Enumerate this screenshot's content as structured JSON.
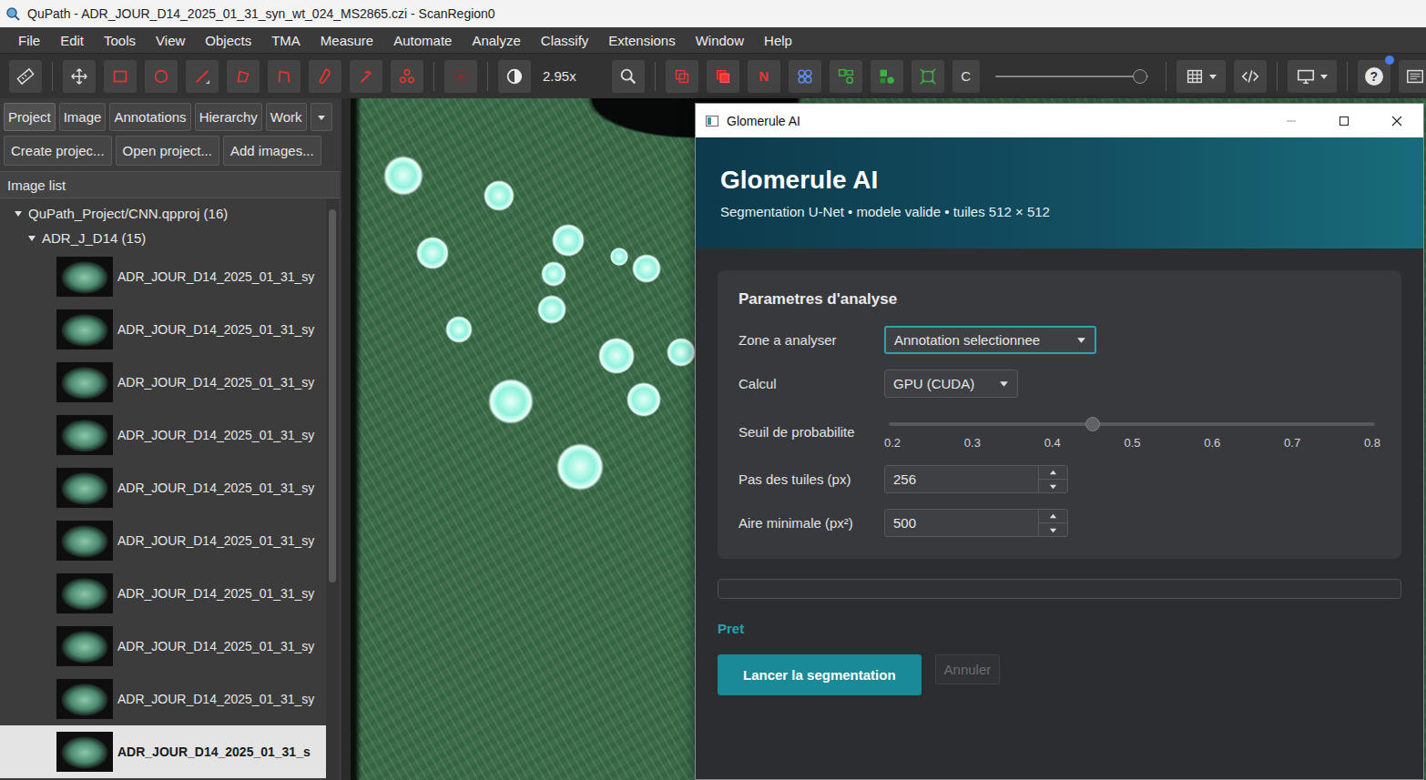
{
  "window": {
    "title": "QuPath - ADR_JOUR_D14_2025_01_31_syn_wt_024_MS2865.czi - ScanRegion0"
  },
  "menu": [
    "File",
    "Edit",
    "Tools",
    "View",
    "Objects",
    "TMA",
    "Measure",
    "Automate",
    "Analyze",
    "Classify",
    "Extensions",
    "Window",
    "Help"
  ],
  "toolbar": {
    "zoom": "2.95x",
    "n_button": "N",
    "channel_button": "C",
    "opacity_level": 0.95,
    "help_glyph": "?",
    "notification": true
  },
  "left_panel": {
    "tabs": [
      {
        "label": "Project",
        "selected": true
      },
      {
        "label": "Image",
        "selected": false
      },
      {
        "label": "Annotations",
        "selected": false
      },
      {
        "label": "Hierarchy",
        "selected": false
      },
      {
        "label": "Work",
        "selected": false
      }
    ],
    "buttons": [
      "Create projec...",
      "Open project...",
      "Add images..."
    ],
    "list_title": "Image list",
    "project": {
      "label": "QuPath_Project/CNN.qpproj (16)",
      "expanded": true
    },
    "group": {
      "label": "ADR_J_D14 (15)",
      "expanded": true
    },
    "images": [
      {
        "label": "ADR_JOUR_D14_2025_01_31_sy",
        "selected": false
      },
      {
        "label": "ADR_JOUR_D14_2025_01_31_sy",
        "selected": false
      },
      {
        "label": "ADR_JOUR_D14_2025_01_31_sy",
        "selected": false
      },
      {
        "label": "ADR_JOUR_D14_2025_01_31_sy",
        "selected": false
      },
      {
        "label": "ADR_JOUR_D14_2025_01_31_sy",
        "selected": false
      },
      {
        "label": "ADR_JOUR_D14_2025_01_31_sy",
        "selected": false
      },
      {
        "label": "ADR_JOUR_D14_2025_01_31_sy",
        "selected": false
      },
      {
        "label": "ADR_JOUR_D14_2025_01_31_sy",
        "selected": false
      },
      {
        "label": "ADR_JOUR_D14_2025_01_31_sy",
        "selected": false
      },
      {
        "label": "ADR_JOUR_D14_2025_01_31_s",
        "selected": true
      }
    ]
  },
  "dialog": {
    "title": "Glomerule AI",
    "heading": "Glomerule AI",
    "subtitle": "Segmentation U-Net • modele valide • tuiles 512 × 512",
    "section_title": "Parametres d'analyse",
    "fields": [
      {
        "kind": "select",
        "label": "Zone a analyser",
        "value": "Annotation selectionnee",
        "focused": true
      },
      {
        "kind": "select",
        "label": "Calcul",
        "value": "GPU (CUDA)",
        "focused": false
      },
      {
        "kind": "slider",
        "label": "Seuil de probabilite",
        "level": 0.42,
        "ticks": [
          "0.2",
          "0.3",
          "0.4",
          "0.5",
          "0.6",
          "0.7",
          "0.8"
        ]
      },
      {
        "kind": "spinner",
        "label": "Pas des tuiles (px)",
        "value": "256"
      },
      {
        "kind": "spinner",
        "label": "Aire minimale (px²)",
        "value": "500"
      }
    ],
    "progress": {
      "level": 0
    },
    "status": "Pret",
    "buttons": [
      {
        "label": "Lancer la segmentation",
        "primary": true,
        "disabled": false
      },
      {
        "label": "Annuler",
        "primary": false,
        "disabled": true
      }
    ]
  }
}
